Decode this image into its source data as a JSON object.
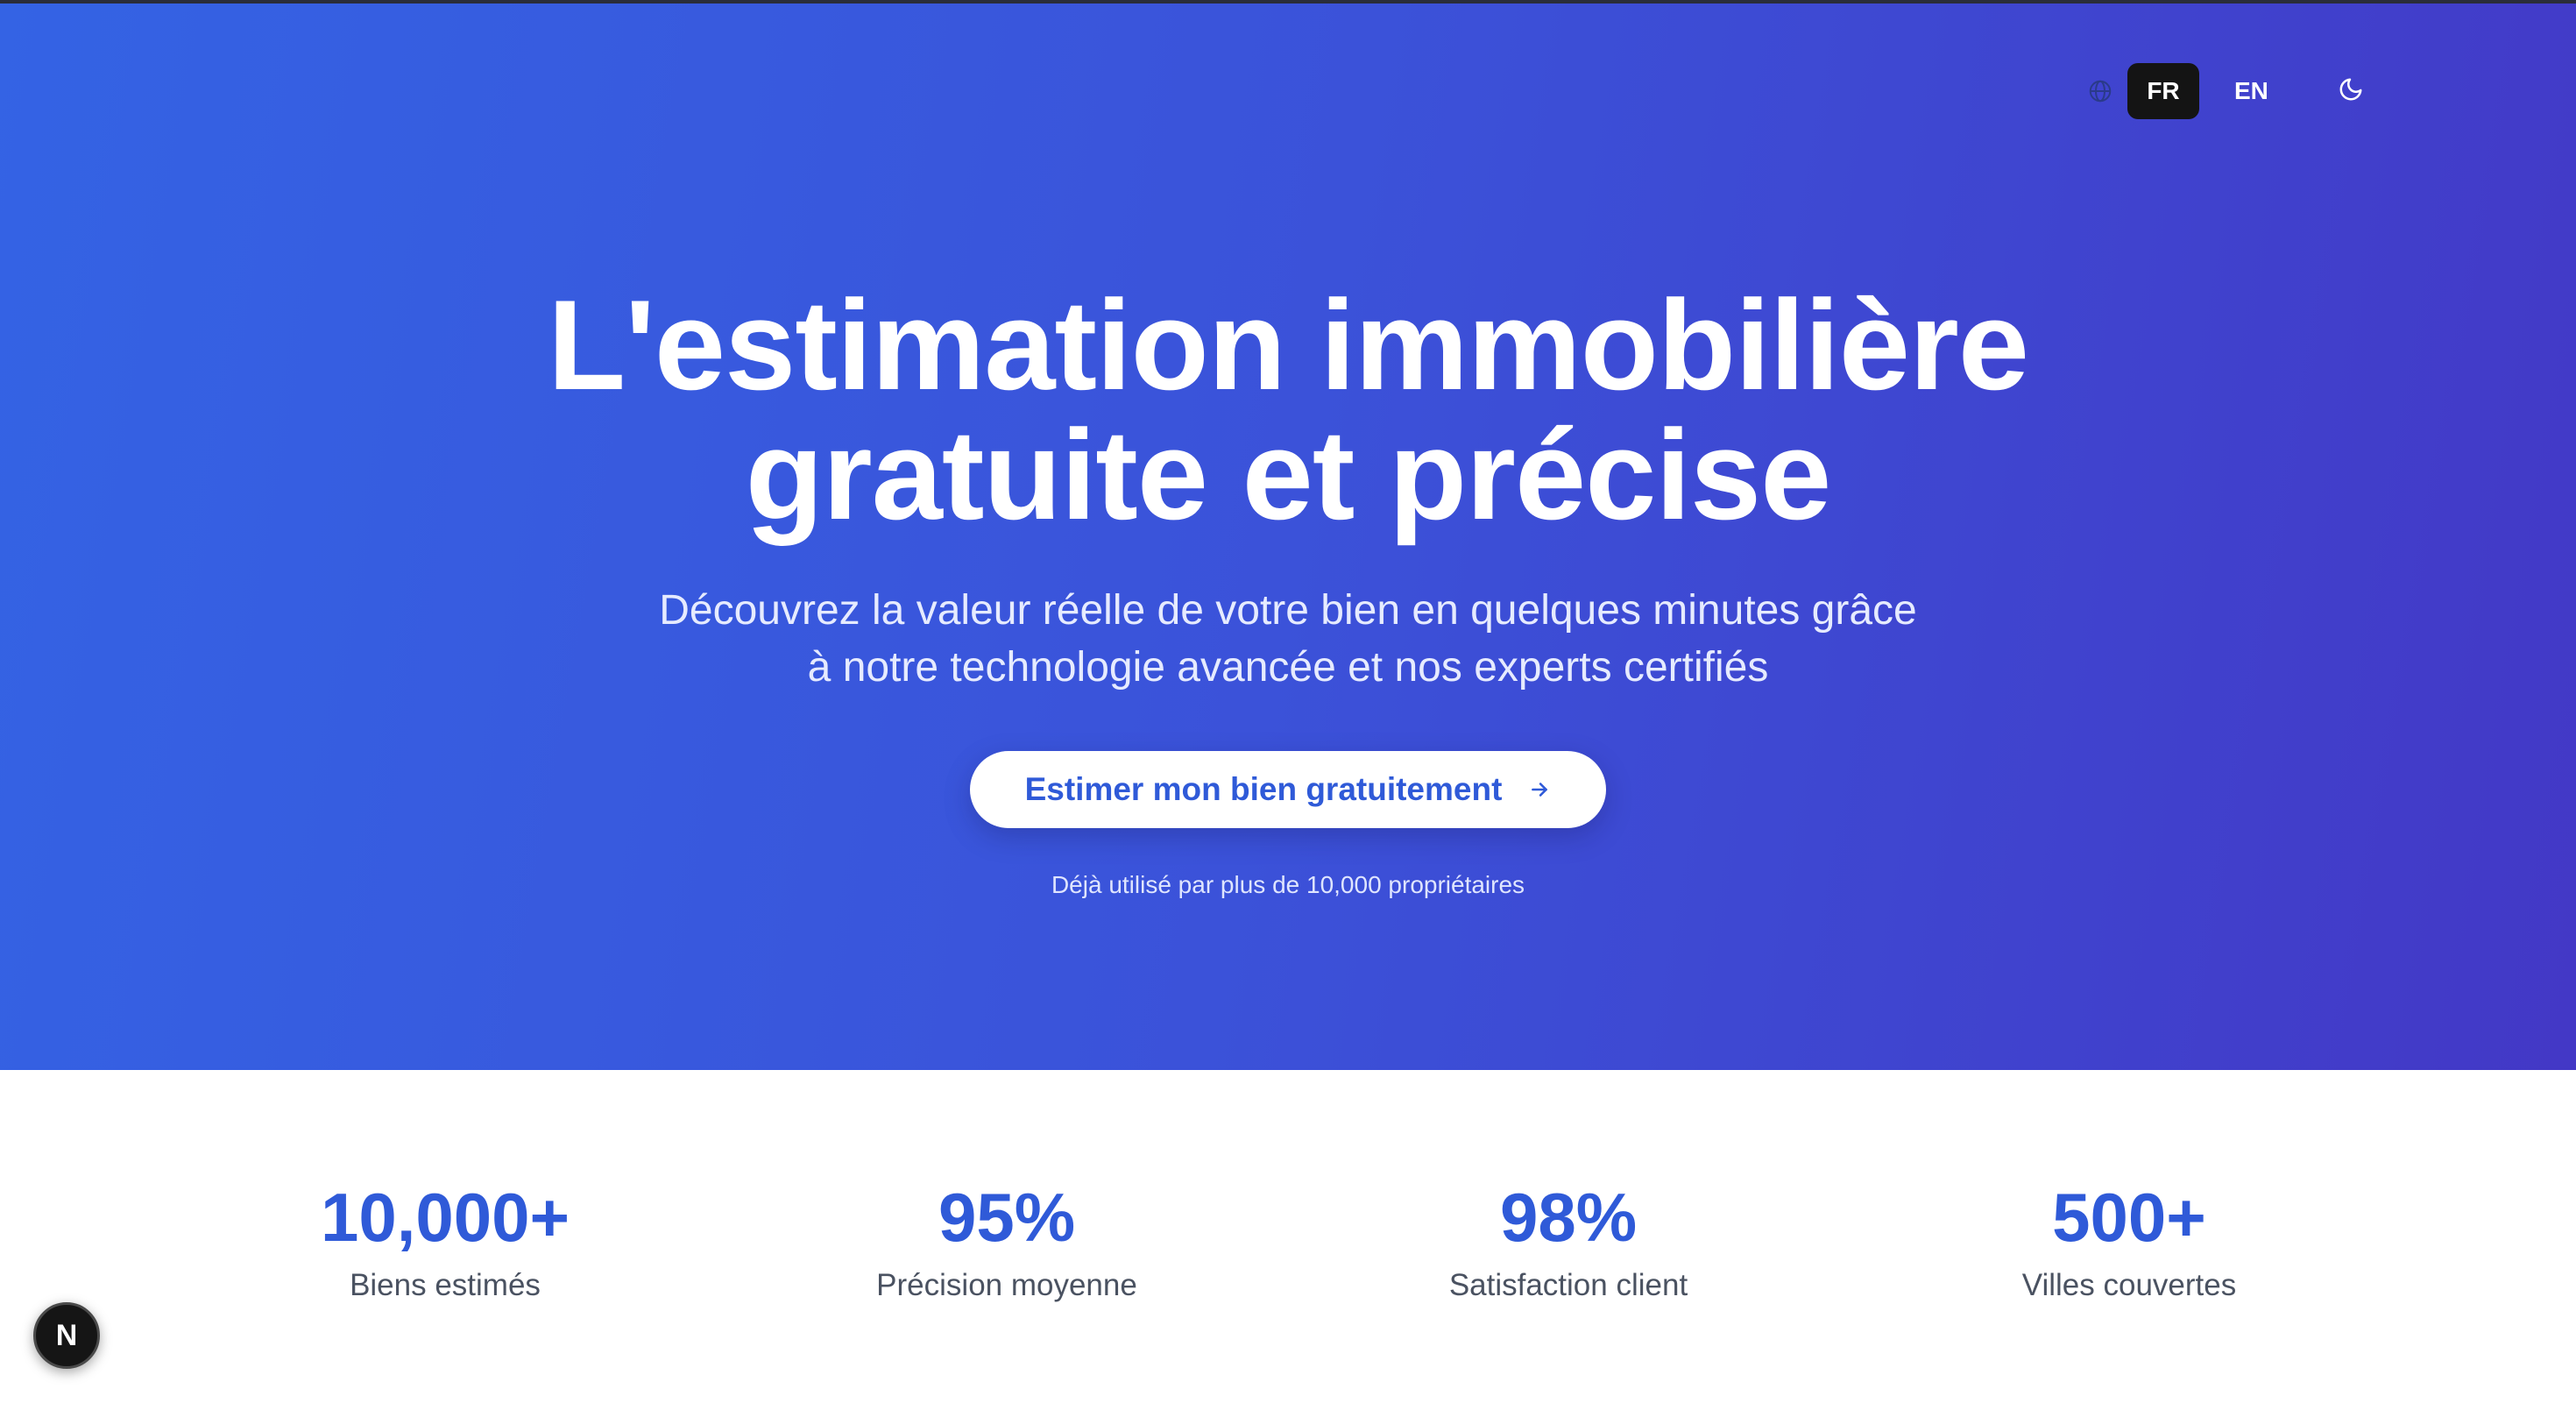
{
  "header": {
    "lang_options": [
      "FR",
      "EN"
    ],
    "active_lang": "FR",
    "globe_icon": "globe-icon",
    "theme_icon": "moon-icon"
  },
  "hero": {
    "title_line1": "L'estimation immobilière",
    "title_line2": "gratuite et précise",
    "subtitle_line1": "Découvrez la valeur réelle de votre bien en quelques minutes grâce",
    "subtitle_line2": "à notre technologie avancée et nos experts certifiés",
    "cta_label": "Estimer mon bien gratuitement",
    "cta_icon": "arrow-right-icon",
    "social_proof": "Déjà utilisé par plus de 10,000 propriétaires"
  },
  "stats": [
    {
      "value": "10,000+",
      "label": "Biens estimés"
    },
    {
      "value": "95%",
      "label": "Précision moyenne"
    },
    {
      "value": "98%",
      "label": "Satisfaction client"
    },
    {
      "value": "500+",
      "label": "Villes couvertes"
    }
  ],
  "dev_badge": {
    "label": "N"
  },
  "colors": {
    "gradient_start": "#3463e4",
    "gradient_end": "#4338c6",
    "accent": "#2f5ad8",
    "active_lang_bg": "#141414"
  }
}
